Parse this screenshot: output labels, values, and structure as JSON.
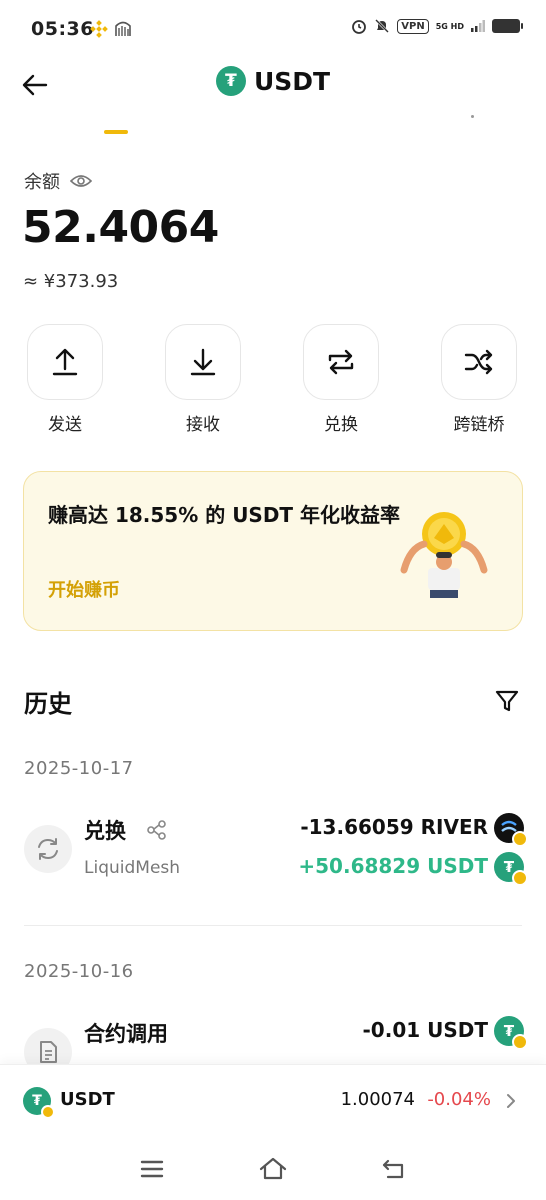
{
  "status_bar": {
    "time": "05:36",
    "vpn": "VPN",
    "network": "5G HD"
  },
  "header": {
    "title": "USDT",
    "token_glyph": "₮"
  },
  "balance": {
    "label": "余额",
    "value": "52.4064",
    "fiat": "≈ ¥373.93"
  },
  "actions": [
    {
      "label": "发送",
      "icon": "upload-arrow-icon"
    },
    {
      "label": "接收",
      "icon": "download-arrow-icon"
    },
    {
      "label": "兑换",
      "icon": "swap-icon"
    },
    {
      "label": "跨链桥",
      "icon": "shuffle-icon"
    }
  ],
  "promo": {
    "title": "赚高达 18.55% 的 USDT 年化收益率",
    "link": "开始赚币"
  },
  "history": {
    "title": "历史",
    "groups": [
      {
        "date": "2025-10-17",
        "tx": {
          "title": "兑换",
          "subtitle": "LiquidMesh",
          "amount_out": "-13.66059 RIVER",
          "amount_in": "+50.68829 USDT"
        }
      },
      {
        "date": "2025-10-16",
        "tx": {
          "title": "合约调用",
          "amount_out": "-0.01 USDT"
        }
      }
    ]
  },
  "ticker": {
    "name": "USDT",
    "price": "1.00074",
    "change": "-0.04%"
  },
  "colors": {
    "accent": "#f0b90b",
    "usdt": "#26a17b",
    "positive": "#2eb889",
    "negative": "#e5484d"
  }
}
